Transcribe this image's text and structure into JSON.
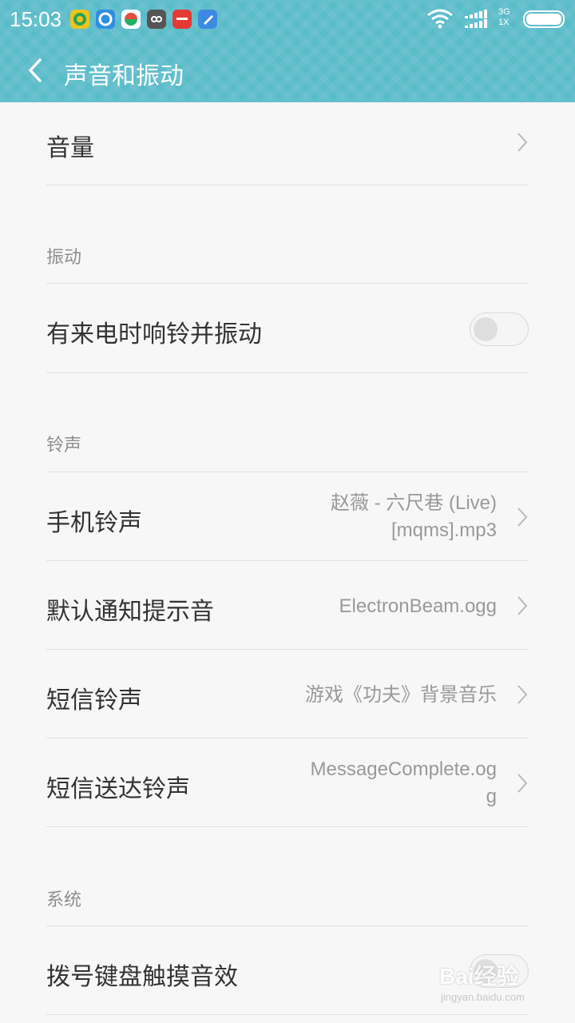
{
  "status_bar": {
    "time": "15:03",
    "network": "3G",
    "network_sub": "1X",
    "notification_icons": [
      "app-icon-1",
      "app-icon-2",
      "app-icon-3",
      "app-icon-4",
      "app-icon-5",
      "app-icon-6"
    ]
  },
  "header": {
    "title": "声音和振动"
  },
  "items": {
    "volume": {
      "label": "音量"
    },
    "vibrate_section": "振动",
    "ring_vibrate": {
      "label": "有来电时响铃并振动",
      "enabled": false
    },
    "ringtone_section": "铃声",
    "phone_ringtone": {
      "label": "手机铃声",
      "value_line1": "赵薇 - 六尺巷 (Live)",
      "value_line2": "[mqms].mp3"
    },
    "notification_sound": {
      "label": "默认通知提示音",
      "value": "ElectronBeam.ogg"
    },
    "sms_ringtone": {
      "label": "短信铃声",
      "value": "游戏《功夫》背景音乐"
    },
    "sms_delivered": {
      "label": "短信送达铃声",
      "value_line1": "MessageComplete.og",
      "value_line2": "g"
    },
    "system_section": "系统",
    "dialpad_touch": {
      "label": "拨号键盘触摸音效",
      "enabled": false
    }
  },
  "watermark": {
    "text": "Bai经验",
    "sub": "jingyan.baidu.com"
  },
  "colors": {
    "header_bg": "#5bbcc9",
    "page_bg": "#f7f7f7"
  }
}
